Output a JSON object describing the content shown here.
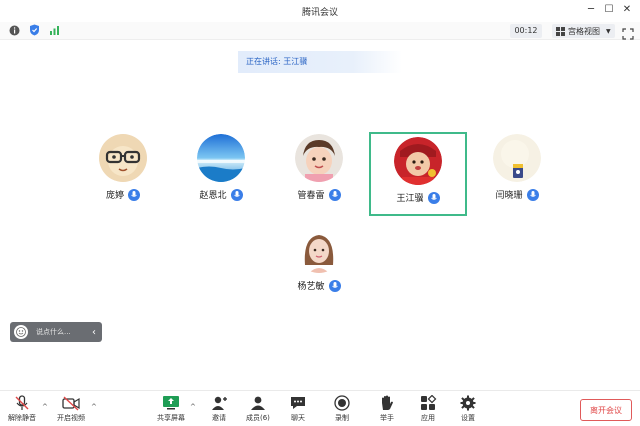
{
  "window": {
    "title": "腾讯会议"
  },
  "infobar": {
    "timer": "00:12",
    "view_label": "宫格视图"
  },
  "speaking": {
    "text": "正在讲话: 王江骥"
  },
  "participants": [
    {
      "name": "庞婷",
      "avatar": "glasses-cartoon-avatar"
    },
    {
      "name": "赵恩北",
      "avatar": "sea-scene-avatar"
    },
    {
      "name": "管春雷",
      "avatar": "child-photo-avatar"
    },
    {
      "name": "王江骥",
      "avatar": "baby-red-photo-avatar",
      "active": true
    },
    {
      "name": "闫晓珊",
      "avatar": "cup-photo-avatar"
    },
    {
      "name": "杨艺敏",
      "avatar": "girl-illustration-avatar"
    }
  ],
  "chat": {
    "placeholder": "说点什么..."
  },
  "toolbar": {
    "unmute": "解除静音",
    "start_video": "开启视频",
    "share_screen": "共享屏幕",
    "invite": "邀请",
    "members": "成员(6)",
    "chat": "聊天",
    "record": "录制",
    "raise_hand": "举手",
    "apps": "应用",
    "settings": "设置",
    "leave": "离开会议"
  },
  "colors": {
    "accent_blue": "#3a7ee8",
    "active_border": "#3fba8a",
    "leave_red": "#e04848"
  }
}
